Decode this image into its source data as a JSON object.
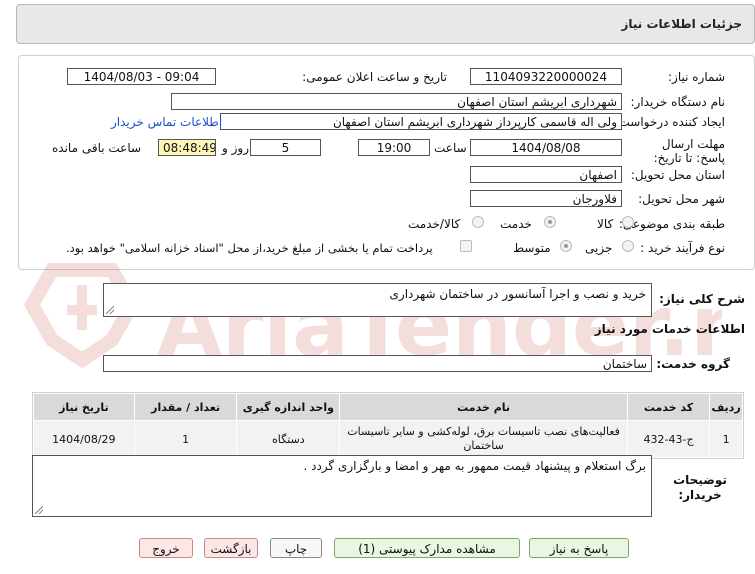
{
  "header": {
    "title": "جزئیات اطلاعات نیاز"
  },
  "form": {
    "need_number": {
      "label": "شماره نیاز:",
      "value": "1104093220000024"
    },
    "announce_datetime": {
      "label": "تاریخ و ساعت اعلان عمومی:",
      "value": "1404/08/03 - 09:04"
    },
    "buyer_org": {
      "label": "نام دستگاه خریدار:",
      "value": "شهرداری ابریشم استان اصفهان"
    },
    "requester": {
      "label": "ایجاد کننده درخواست:",
      "value": "ولی اله قاسمی کارپرداز شهرداری ابریشم استان اصفهان",
      "contact_link": "اطلاعات تماس خریدار"
    },
    "deadline": {
      "label": "مهلت ارسال پاسخ: تا تاریخ:",
      "date": "1404/08/08",
      "time_label": "ساعت",
      "time": "19:00",
      "days": "5",
      "days_label": "روز و",
      "remaining": "08:48:49",
      "remaining_label": "ساعت باقی مانده"
    },
    "province": {
      "label": "استان محل تحویل:",
      "value": "اصفهان"
    },
    "city": {
      "label": "شهر محل تحویل:",
      "value": "فلاورجان"
    },
    "category": {
      "label": "طبقه بندی موضوعی:",
      "options": [
        "کالا",
        "خدمت",
        "کالا/خدمت"
      ],
      "selected": "خدمت"
    },
    "purchase_type": {
      "label": "نوع فرآیند خرید :",
      "options": [
        "جزیی",
        "متوسط"
      ],
      "selected": "متوسط",
      "note": "پرداخت تمام یا بخشی از مبلغ خرید،از محل \"اسناد خزانه اسلامی\" خواهد بود."
    }
  },
  "summary": {
    "label": "شرح کلی نیاز:",
    "value": "خرید و نصب و اجرا آسانسور در ساختمان شهرداری"
  },
  "services": {
    "section_title": "اطلاعات خدمات مورد نیاز",
    "group_label": "گروه خدمت:",
    "group_value": "ساختمان",
    "table": {
      "headers": [
        "ردیف",
        "کد خدمت",
        "نام خدمت",
        "واحد اندازه گیری",
        "تعداد / مقدار",
        "تاریخ نیاز"
      ],
      "rows": [
        [
          "1",
          "ج-43-432",
          "فعالیت‌های نصب تاسیسات برق، لوله‌کشی و سایر تاسیسات ساختمان",
          "دستگاه",
          "1",
          "1404/08/29"
        ]
      ]
    }
  },
  "buyer_notes": {
    "label": "توضیحات خریدار:",
    "value": "برگ استعلام و پیشنهاد قیمت ممهور به مهر و امضا و بارگزاری گردد ."
  },
  "buttons": {
    "reply": "پاسخ به نیاز",
    "attachments": "مشاهده مدارک پیوستی (1)",
    "print": "چاپ",
    "back": "بازگشت",
    "exit": "خروج"
  },
  "watermark": {
    "text": "AriaTender.net",
    "color": "#c0392b"
  }
}
